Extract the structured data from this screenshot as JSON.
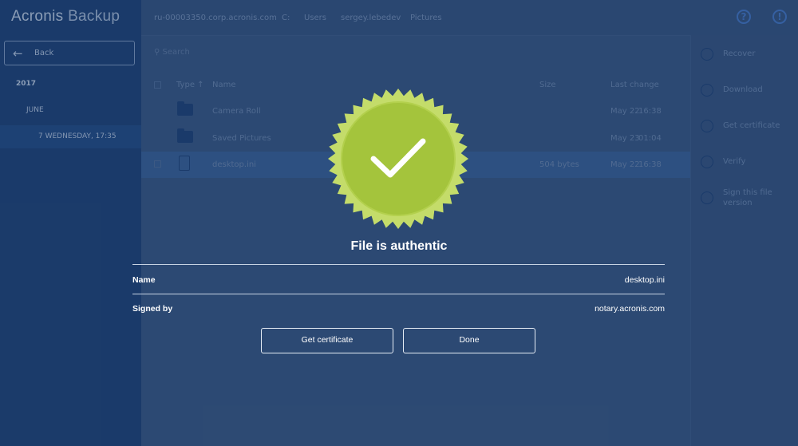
{
  "app": {
    "brand_main": "Acronis",
    "brand_sub": "Backup"
  },
  "sidebar": {
    "back_label": "Back",
    "year": "2017",
    "month": "JUNE",
    "day": "7 WEDNESDAY, 17:35"
  },
  "breadcrumb": [
    "ru-00003350.corp.acronis.com",
    "C:",
    "Users",
    "sergey.lebedev",
    "Pictures"
  ],
  "search": {
    "placeholder": "Search"
  },
  "table": {
    "headers": {
      "type": "Type",
      "name": "Name",
      "size": "Size",
      "last_change": "Last change"
    },
    "rows": [
      {
        "name": "Camera Roll",
        "size": "",
        "date": "May 22",
        "time": "16:38"
      },
      {
        "name": "Saved Pictures",
        "size": "",
        "date": "May 23",
        "time": "01:04"
      },
      {
        "name": "desktop.ini",
        "size": "504 bytes",
        "date": "May 22",
        "time": "16:38"
      }
    ]
  },
  "actions": [
    {
      "label": "Recover",
      "icon": "recover-icon"
    },
    {
      "label": "Download",
      "icon": "download-icon"
    },
    {
      "label": "Get certificate",
      "icon": "certificate-icon"
    },
    {
      "label": "Verify",
      "icon": "verify-icon"
    },
    {
      "label": "Sign this file version",
      "icon": "sign-icon"
    }
  ],
  "modal": {
    "title": "File is authentic",
    "name_label": "Name",
    "name_value": "desktop.ini",
    "signed_label": "Signed by",
    "signed_value": "notary.acronis.com",
    "get_certificate_label": "Get certificate",
    "done_label": "Done",
    "badge_icon": "checkmark-seal-icon"
  },
  "colors": {
    "overlay": "#2d4a73",
    "sidebar": "#0c2f63",
    "seal_outer": "#c4dc6a",
    "seal_inner": "#a4c43c",
    "accent": "#3d74c9"
  }
}
